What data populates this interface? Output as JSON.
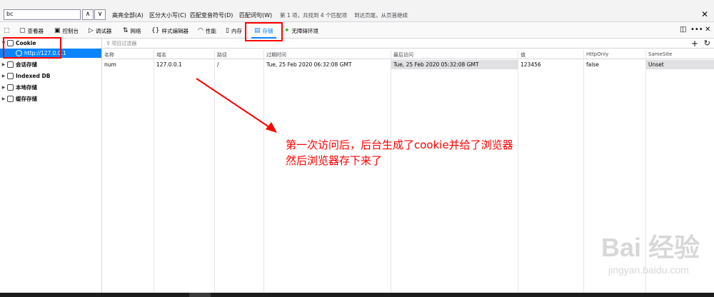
{
  "findbar": {
    "query": "bc",
    "options": [
      "高亮全部(A)",
      "区分大小写(C)",
      "匹配变音符号(D)",
      "匹配词句(W)"
    ],
    "status": "第 1 项，共找到 4 个匹配项",
    "status_hint": "到达页尾，从页首继续"
  },
  "toolbar": {
    "tools": [
      {
        "label": "查看器",
        "icon": "inspector-icon"
      },
      {
        "label": "控制台",
        "icon": "console-icon"
      },
      {
        "label": "调试器",
        "icon": "debugger-icon"
      },
      {
        "label": "网络",
        "icon": "network-icon"
      },
      {
        "label": "样式编辑器",
        "icon": "style-editor-icon"
      },
      {
        "label": "性能",
        "icon": "performance-icon"
      },
      {
        "label": "内存",
        "icon": "memory-icon"
      },
      {
        "label": "存储",
        "icon": "storage-icon"
      },
      {
        "label": "无障碍环境",
        "icon": "accessibility-icon"
      }
    ],
    "selected": "存储"
  },
  "sidebar": {
    "items": [
      {
        "label": "Cookie",
        "expanded": true
      },
      {
        "label": "http://127.0.0.1",
        "selected": true
      },
      {
        "label": "会话存储"
      },
      {
        "label": "Indexed DB"
      },
      {
        "label": "本地存储"
      },
      {
        "label": "缓存存储"
      }
    ]
  },
  "filter": {
    "placeholder": "项目过滤器"
  },
  "table": {
    "headers": [
      "名称",
      "域名",
      "路径",
      "过期时间",
      "最后访问",
      "值",
      "HttpOnly",
      "SameSite"
    ],
    "rows": [
      [
        "num",
        "127.0.0.1",
        "/",
        "Tue, 25 Feb 2020 06:32:08 GMT",
        "Tue, 25 Feb 2020 05:32:08 GMT",
        "123456",
        "false",
        "Unset"
      ]
    ]
  },
  "annotation": {
    "line1": "第一次访问后，后台生成了cookie并给了浏览器",
    "line2": "然后浏览器存下来了",
    "color": "#ff0000"
  },
  "watermark": {
    "main": "Bai 经验",
    "sub": "jingyan.baidu.com"
  },
  "colors": {
    "accent": "#0a84ff",
    "annotation": "#ff0000"
  }
}
